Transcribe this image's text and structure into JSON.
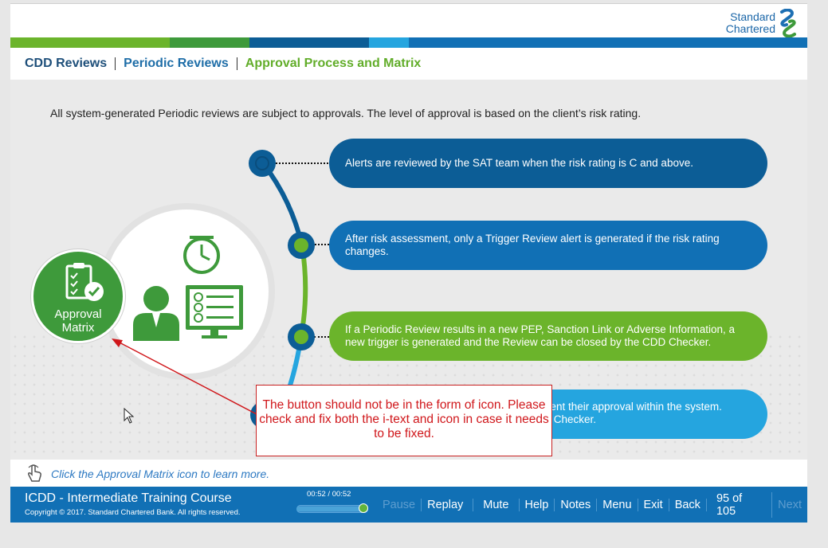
{
  "logo": {
    "line1": "Standard",
    "line2": "Chartered"
  },
  "colors": {
    "stripe": [
      "#6bb42b",
      "#3e9a3b",
      "#0c5d96",
      "#25a5df",
      "#1170b5"
    ]
  },
  "breadcrumb": [
    {
      "label": "CDD Reviews",
      "color": "#1e4f7a"
    },
    {
      "label": "Periodic Reviews",
      "color": "#1f6ea8"
    },
    {
      "label": "Approval Process and Matrix",
      "color": "#62ad2a"
    }
  ],
  "intro": "All system-generated Periodic reviews are subject to approvals. The level of approval is based on the client’s risk rating.",
  "steps": [
    {
      "text": "Alerts are reviewed by the SAT team when the risk rating is C and above.",
      "color": "#0c5d96"
    },
    {
      "text": "After risk assessment, only a Trigger Review alert is generated if the risk rating changes.",
      "color": "#1170b5"
    },
    {
      "text": "If a Periodic Review results in a new PEP, Sanction Link or Adverse Information, a new trigger is generated and the Review can be closed by the CDD Checker.",
      "color": "#6bb42b"
    },
    {
      "text": "nent their approval within the system.",
      "text2": "T Checker.",
      "color": "#25a5df"
    }
  ],
  "approval_button": {
    "line1": "Approval",
    "line2": "Matrix"
  },
  "callout": "The button should not be in the form of icon. Please check and fix both the i-text and icon in case it needs to be fixed.",
  "hint": "Click the Approval Matrix icon to learn more.",
  "footer": {
    "course_title": "ICDD - Intermediate Training Course",
    "copyright": "Copyright © 2017. Standard Chartered Bank. All rights reserved.",
    "time": "00:52 / 00:52",
    "progress": 1.0,
    "controls": {
      "pause": "Pause",
      "replay": "Replay",
      "mute": "Mute",
      "help": "Help",
      "notes": "Notes",
      "menu": "Menu",
      "exit": "Exit",
      "back": "Back",
      "counter": "95 of 105",
      "next": "Next"
    }
  }
}
